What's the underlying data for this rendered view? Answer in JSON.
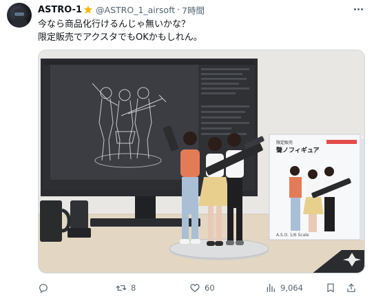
{
  "tweet": {
    "display_name": "ASTRO-1",
    "handle": "@ASTRO_1_airsoft",
    "separator": "·",
    "time": "7時間",
    "lines": [
      "今なら商品化行けるんじゃ無いかな？",
      "限定販売でアクスタでもOKかもしれん。"
    ]
  },
  "box": {
    "small_text": "限定販売",
    "title": "聲ノフィギュア",
    "model_line": "A.S.O. 1/6 Scale"
  },
  "actions": {
    "reply_count": "",
    "retweet_count": "8",
    "like_count": "60",
    "view_count": "9,064"
  },
  "colors": {
    "text": "#0f1419",
    "muted": "#536471",
    "border": "#cfd9de",
    "badge": "#f4b400"
  }
}
